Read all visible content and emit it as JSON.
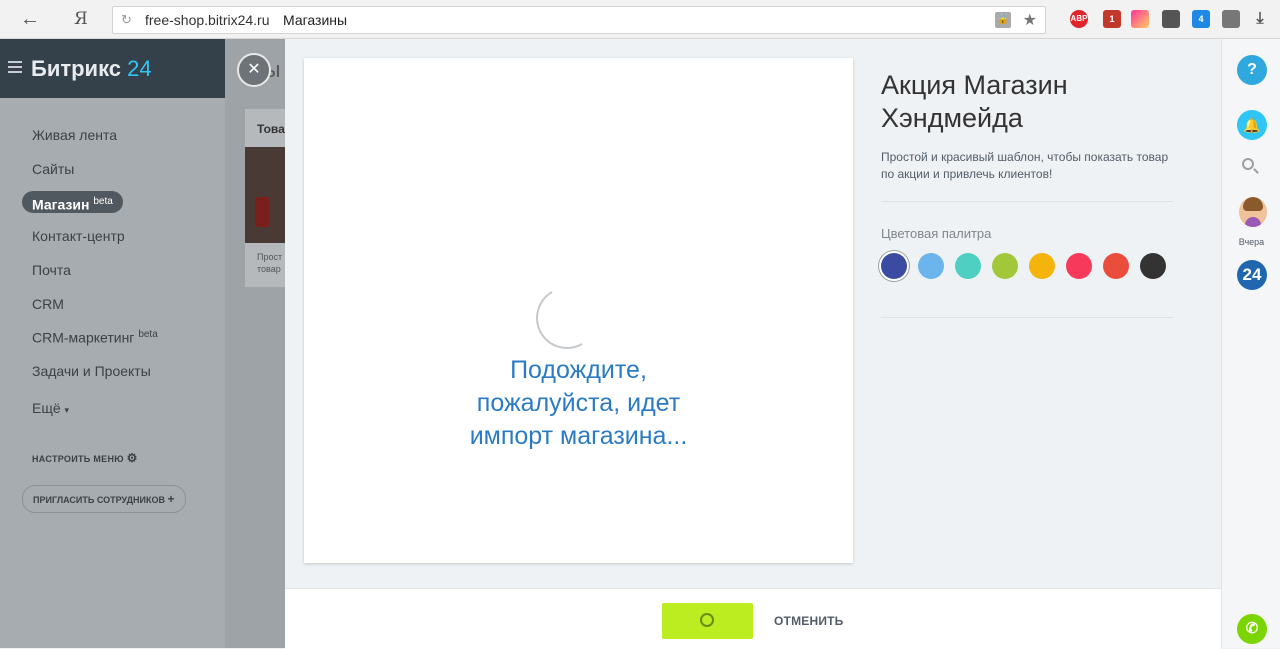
{
  "browser": {
    "ya_label": "Я",
    "domain": "free-shop.bitrix24.ru",
    "page_title": "Магазины",
    "extensions": [
      {
        "icon": "adblock-icon",
        "label": "ABP",
        "color": "#e0242b"
      },
      {
        "icon": "extension-badge-icon",
        "label": "1",
        "color": "#c0392b"
      },
      {
        "icon": "gradient-extension-icon",
        "label": "",
        "color": "#e84393"
      },
      {
        "icon": "cursor-extension-icon",
        "label": "",
        "color": "#333333"
      },
      {
        "icon": "s-extension-icon",
        "label": "4",
        "color": "#1e88e5"
      },
      {
        "icon": "pin-extension-icon",
        "label": "",
        "color": "#555555"
      },
      {
        "icon": "download-icon",
        "label": "",
        "color": "#555555"
      }
    ]
  },
  "leftmenu": {
    "logo_text": "Битрикс",
    "logo_num": "24",
    "items": [
      {
        "label": "Живая лента"
      },
      {
        "label": "Сайты"
      },
      {
        "label": "Контакт-центр"
      },
      {
        "label": "Почта"
      },
      {
        "label": "CRM"
      },
      {
        "label": "CRM-маркетинг",
        "badge": "beta"
      },
      {
        "label": "Задачи и Проекты"
      },
      {
        "label": "Ещё"
      }
    ],
    "active": {
      "label": "Магазин",
      "badge": "beta"
    },
    "configure_label": "НАСТРОИТЬ МЕНЮ",
    "invite_label": "ПРИГЛАСИТЬ СОТРУДНИКОВ"
  },
  "background_page": {
    "heading_fragment": "Вы",
    "card_title_fragment": "Това",
    "card_desc_fragment1": "Прост",
    "card_desc_fragment2": "товар"
  },
  "slider": {
    "wait_line1": "Подождите,",
    "wait_line2": "пожалуйста, идет",
    "wait_line3": "импорт магазина...",
    "title_line1": "Акция Магазин",
    "title_line2": "Хэндмейда",
    "description": "Простой и красивый шаблон, чтобы показать товар по акции и привлечь клиентов!",
    "palette_label": "Цветовая палитра",
    "palette": [
      "#3a4ba1",
      "#6cb4ec",
      "#4ecfc2",
      "#a3c73a",
      "#f5b40c",
      "#f73a5c",
      "#ea4d3c",
      "#333333"
    ],
    "palette_selected": 0,
    "cancel_label": "ОТМЕНИТЬ"
  },
  "rightbar": {
    "help_label": "?",
    "yesterday_label": "Вчера",
    "b24_label": "24",
    "colors": {
      "help": "#2fa8de",
      "bell": "#2fc6f6",
      "b24": "#2067b0",
      "phone": "#7bd500"
    }
  }
}
